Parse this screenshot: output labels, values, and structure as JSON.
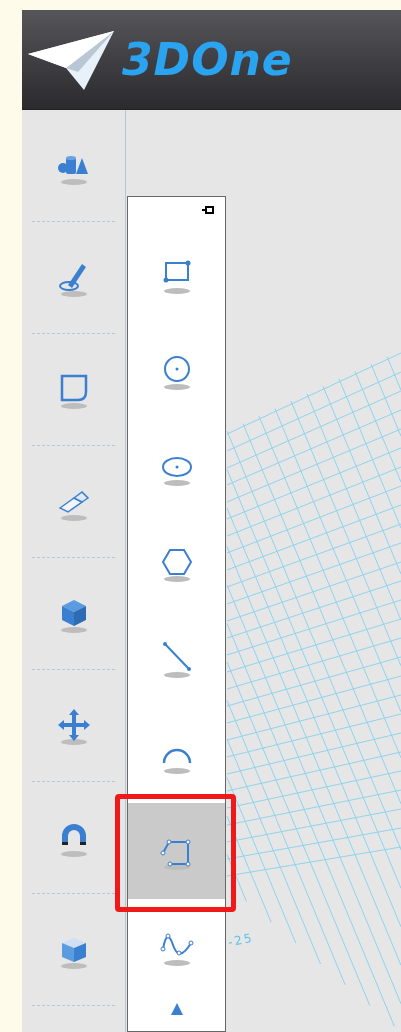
{
  "header": {
    "logo_text": "3DOne"
  },
  "toolbar": [
    {
      "kind": "primitives"
    },
    {
      "kind": "sketch"
    },
    {
      "kind": "rounded-square"
    },
    {
      "kind": "eraser"
    },
    {
      "kind": "cube"
    },
    {
      "kind": "move"
    },
    {
      "kind": "magnet"
    },
    {
      "kind": "combine"
    }
  ],
  "sketch_panel": {
    "pinned": true,
    "items": [
      {
        "kind": "rectangle",
        "selected": false,
        "annotated": false
      },
      {
        "kind": "circle",
        "selected": false,
        "annotated": false
      },
      {
        "kind": "ellipse",
        "selected": false,
        "annotated": false
      },
      {
        "kind": "polygon",
        "selected": false,
        "annotated": false
      },
      {
        "kind": "line",
        "selected": false,
        "annotated": false
      },
      {
        "kind": "arc",
        "selected": false,
        "annotated": false
      },
      {
        "kind": "polyline",
        "selected": true,
        "annotated": true
      },
      {
        "kind": "spline",
        "selected": false,
        "annotated": false
      },
      {
        "kind": "partial",
        "selected": false,
        "annotated": false
      }
    ]
  },
  "viewport": {
    "axis_label": "-25"
  }
}
